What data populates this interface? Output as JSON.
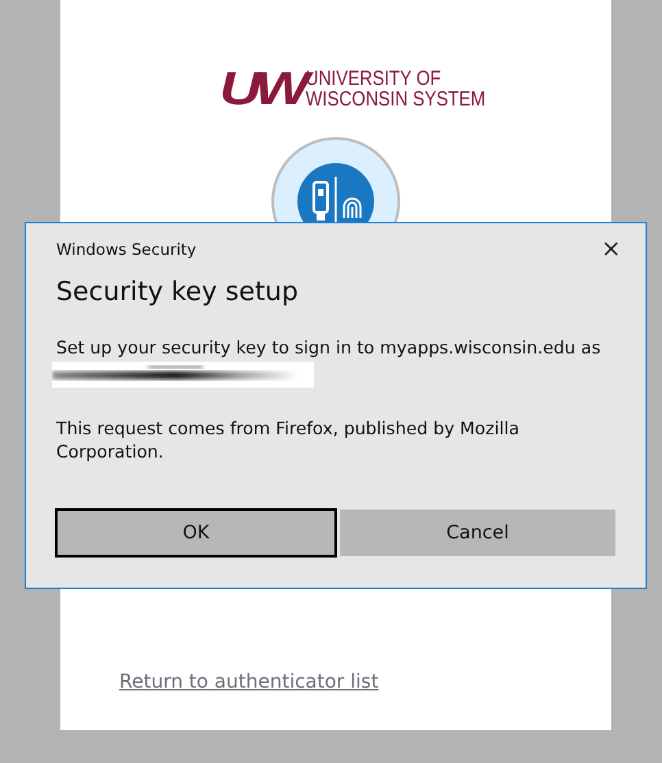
{
  "page": {
    "logo": {
      "mark": "UW",
      "line_1": "UNIVERSITY OF",
      "line_2": "WISCONSIN SYSTEM"
    },
    "link": "Return to authenticator list"
  },
  "dialog": {
    "window_title": "Windows Security",
    "close": "×",
    "heading": "Security key setup",
    "message": "Set up your security key to sign in to myapps.wisconsin.edu as",
    "note": "This request comes from Firefox, published by Mozilla Corporation.",
    "buttons": [
      {
        "label": "OK",
        "default": true
      },
      {
        "label": "Cancel",
        "default": false
      }
    ]
  }
}
